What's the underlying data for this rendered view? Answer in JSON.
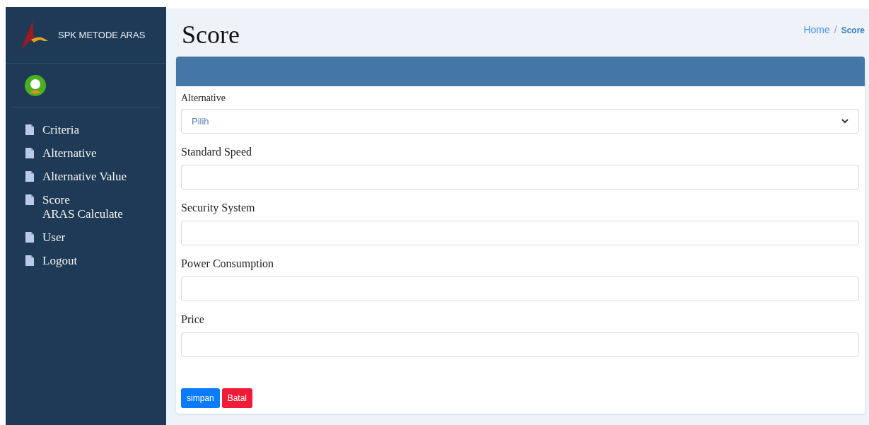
{
  "brand": {
    "title": "SPK METODE ARAS"
  },
  "sidebar": {
    "items": [
      {
        "label": "Criteria"
      },
      {
        "label": "Alternative"
      },
      {
        "label": "Alternative Value"
      },
      {
        "label": "Score\nARAS Calculate"
      },
      {
        "label": "User"
      },
      {
        "label": "Logout"
      }
    ]
  },
  "page": {
    "title": "Score"
  },
  "breadcrumb": [
    {
      "label": "Home",
      "kind": "link"
    },
    {
      "label": "/",
      "kind": "separator"
    },
    {
      "label": "Score",
      "kind": "current"
    }
  ],
  "form": {
    "fields": [
      {
        "label": "Alternative",
        "kind": "select",
        "value": "Pilih"
      },
      {
        "label": "Standard Speed",
        "kind": "text"
      },
      {
        "label": "Security System",
        "kind": "text"
      },
      {
        "label": "Power Consumption",
        "kind": "text"
      },
      {
        "label": "Price",
        "kind": "text"
      }
    ],
    "buttons": [
      {
        "label": "simpan",
        "kind": "primary"
      },
      {
        "label": "Batal",
        "kind": "danger"
      }
    ]
  }
}
